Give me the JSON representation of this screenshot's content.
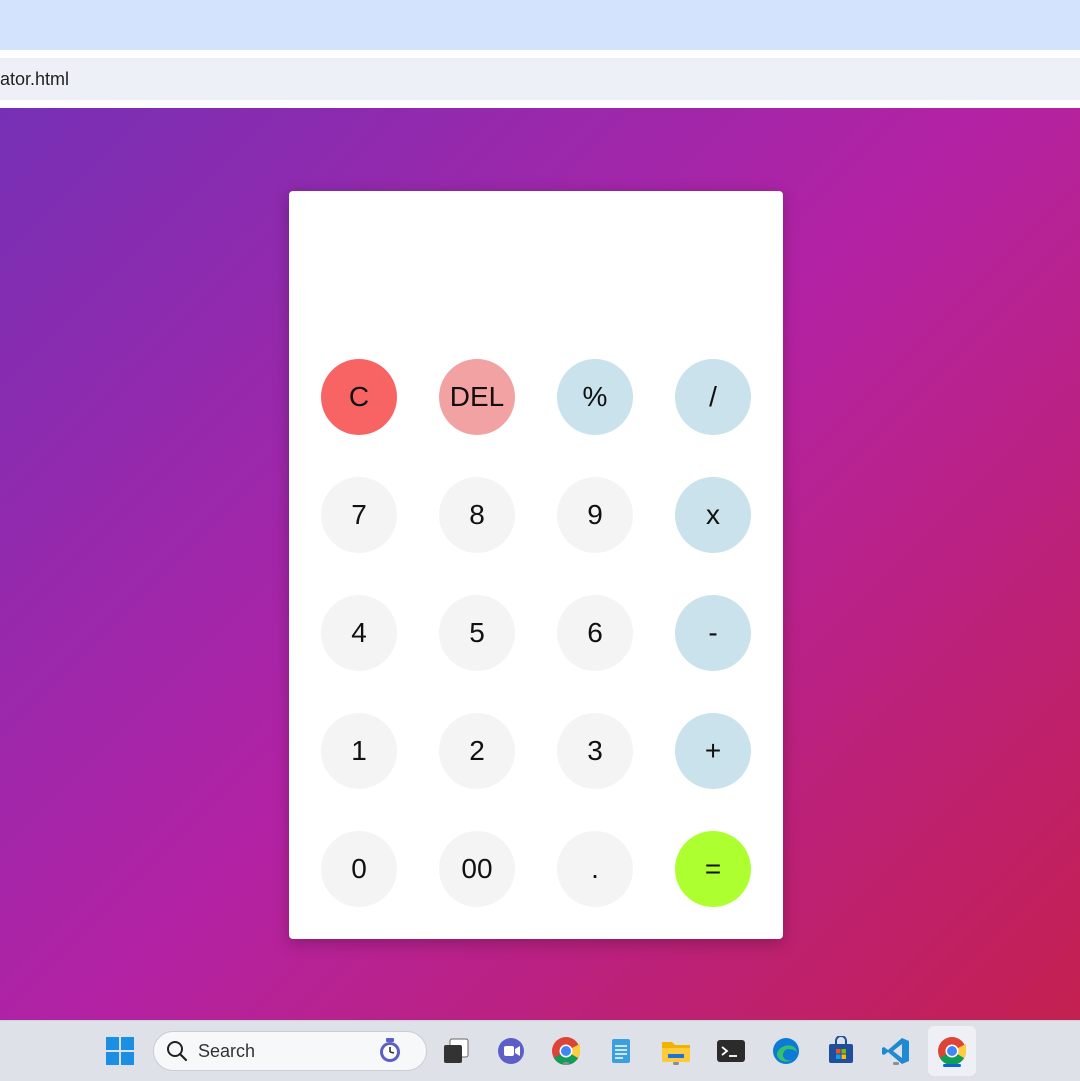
{
  "browser": {
    "address_text": "ator.html"
  },
  "calculator": {
    "display_value": "",
    "buttons": [
      {
        "label": "C",
        "kind": "clear"
      },
      {
        "label": "DEL",
        "kind": "del"
      },
      {
        "label": "%",
        "kind": "op"
      },
      {
        "label": "/",
        "kind": "op"
      },
      {
        "label": "7",
        "kind": "num"
      },
      {
        "label": "8",
        "kind": "num"
      },
      {
        "label": "9",
        "kind": "num"
      },
      {
        "label": "x",
        "kind": "op"
      },
      {
        "label": "4",
        "kind": "num"
      },
      {
        "label": "5",
        "kind": "num"
      },
      {
        "label": "6",
        "kind": "num"
      },
      {
        "label": "-",
        "kind": "op"
      },
      {
        "label": "1",
        "kind": "num"
      },
      {
        "label": "2",
        "kind": "num"
      },
      {
        "label": "3",
        "kind": "num"
      },
      {
        "label": "+",
        "kind": "op"
      },
      {
        "label": "0",
        "kind": "num"
      },
      {
        "label": "00",
        "kind": "num"
      },
      {
        "label": ".",
        "kind": "num"
      },
      {
        "label": "=",
        "kind": "eq"
      }
    ],
    "colors": {
      "clear": "#f86464",
      "delete": "#f2a2a2",
      "operator": "#c9e2ec",
      "number": "#f4f4f4",
      "equals": "#adff2f"
    }
  },
  "taskbar": {
    "search_placeholder": "Search",
    "apps": [
      {
        "icon": "windows-start-icon"
      },
      {
        "icon": "task-view-icon"
      },
      {
        "icon": "meet-icon"
      },
      {
        "icon": "chrome-icon"
      },
      {
        "icon": "notepad-icon"
      },
      {
        "icon": "file-explorer-icon"
      },
      {
        "icon": "terminal-icon"
      },
      {
        "icon": "edge-icon"
      },
      {
        "icon": "store-icon"
      },
      {
        "icon": "vscode-icon"
      },
      {
        "icon": "chrome-active-icon"
      }
    ]
  }
}
